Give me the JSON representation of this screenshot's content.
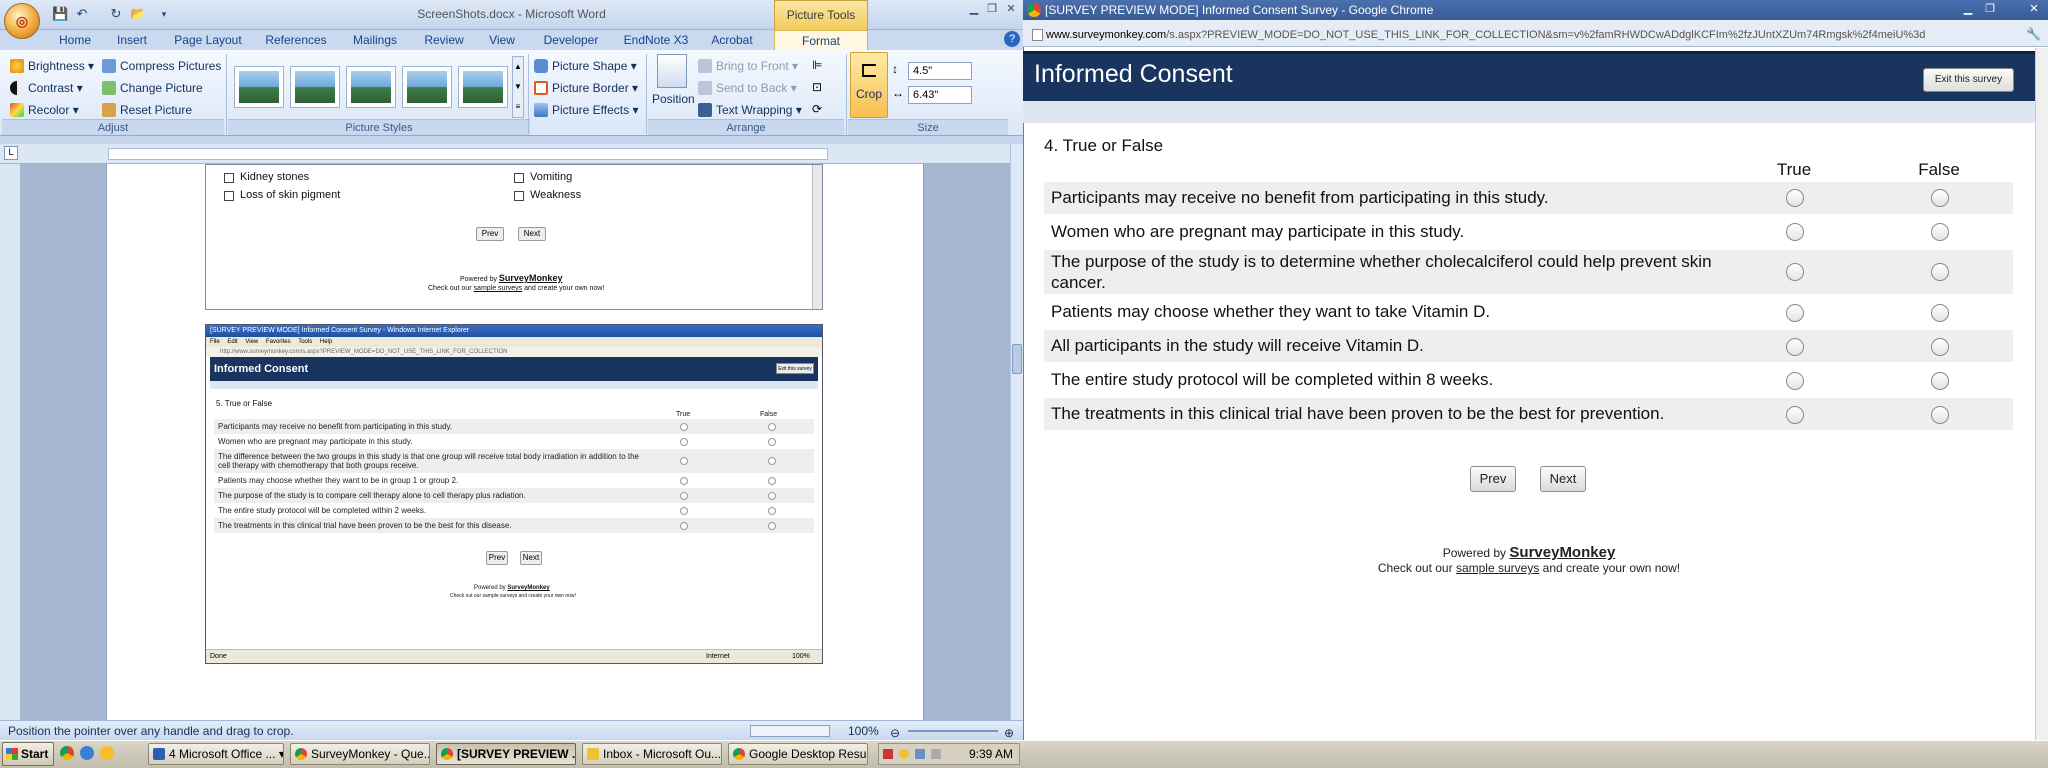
{
  "word": {
    "caption": "ScreenShots.docx - Microsoft Word",
    "picture_tools": "Picture Tools",
    "tabs": [
      "Home",
      "Insert",
      "Page Layout",
      "References",
      "Mailings",
      "Review",
      "View",
      "Developer",
      "EndNote X3",
      "Acrobat",
      "Format"
    ],
    "adjust": {
      "brightness": "Brightness",
      "contrast": "Contrast",
      "recolor": "Recolor",
      "compress": "Compress Pictures",
      "change": "Change Picture",
      "reset": "Reset Picture",
      "label": "Adjust"
    },
    "styles": {
      "shape": "Picture Shape",
      "border": "Picture Border",
      "effects": "Picture Effects",
      "label": "Picture Styles"
    },
    "arrange": {
      "position": "Position",
      "front": "Bring to Front",
      "back": "Send to Back",
      "wrap": "Text Wrapping",
      "label": "Arrange"
    },
    "size": {
      "crop": "Crop",
      "height": "4.5\"",
      "width": "6.43\"",
      "label": "Size"
    },
    "status": "Position the pointer over any handle and drag to crop.",
    "zoom": "100%",
    "doc1": {
      "items": [
        "Kidney stones",
        "Loss of skin pigment",
        "Vomiting",
        "Weakness"
      ],
      "prev": "Prev",
      "next": "Next",
      "powered": "Powered by",
      "brand": "SurveyMonkey",
      "checkout": "Check out our",
      "sample": "sample surveys",
      "create": "and create your own now!"
    },
    "doc2": {
      "title": "[SURVEY PREVIEW MODE] Informed Consent Survey - Windows Internet Explorer",
      "menu": [
        "File",
        "Edit",
        "View",
        "Favorites",
        "Tools",
        "Help"
      ],
      "url": "http://www.surveymonkey.com/s.aspx?PREVIEW_MODE=DO_NOT_USE_THIS_LINK_FOR_COLLECTION",
      "heading": "Informed Consent",
      "exit": "Exit this survey",
      "question": "5. True or False",
      "true": "True",
      "false": "False",
      "rows": [
        "Participants may receive no benefit from participating in this study.",
        "Women who are pregnant may participate in this study.",
        "The difference between the two groups in this study is that one group will receive total body irradiation in addition to the cell therapy with chemotherapy that both groups receive.",
        "Patients may choose whether they want to be in group 1 or group 2.",
        "The purpose of the study is to compare cell therapy alone to cell therapy plus radiation.",
        "The entire study protocol will be completed within 2 weeks.",
        "The treatments in this clinical trial have been proven to be the best for this disease."
      ],
      "prev": "Prev",
      "next": "Next",
      "powered": "Powered by",
      "brand": "SurveyMonkey",
      "checkout": "Check out our sample surveys and create your own now!",
      "status_done": "Done",
      "status_zone": "Internet",
      "status_zoom": "100%"
    }
  },
  "chrome": {
    "title": "[SURVEY PREVIEW MODE] Informed Consent Survey - Google Chrome",
    "url_host": "www.surveymonkey.com",
    "url_path": "/s.aspx?PREVIEW_MODE=DO_NOT_USE_THIS_LINK_FOR_COLLECTION&sm=v%2famRHWDCwADdglKCFIm%2fzJUntXZUm74Rmgsk%2f4meiU%3d"
  },
  "survey": {
    "heading": "Informed Consent",
    "exit": "Exit this survey",
    "question": "4. True or False",
    "col_true": "True",
    "col_false": "False",
    "rows": [
      "Participants may receive no benefit from participating in this study.",
      "Women who are pregnant may participate in this study.",
      "The purpose of the study is to determine whether cholecalciferol could help prevent skin cancer.",
      "Patients may choose whether they want to take Vitamin D.",
      "All participants in the study will receive Vitamin D.",
      "The entire study protocol will be completed within 8 weeks.",
      "The treatments in this clinical trial have been proven to be the best for prevention."
    ],
    "prev": "Prev",
    "next": "Next",
    "powered": "Powered by",
    "brand": "SurveyMonkey",
    "checkout": "Check out our",
    "sample": "sample surveys",
    "create": "and create your own now!"
  },
  "taskbar": {
    "start": "Start",
    "tasks": [
      "4 Microsoft Office ...",
      "SurveyMonkey - Que...",
      "[SURVEY PREVIEW ...",
      "Inbox - Microsoft Ou...",
      "Google Desktop Results"
    ],
    "clock": "9:39 AM"
  },
  "colors": {
    "survey_header": "#19345f",
    "ribbon_bg": "#dbe7f7",
    "taskbar_bg": "#d4d0c8"
  }
}
